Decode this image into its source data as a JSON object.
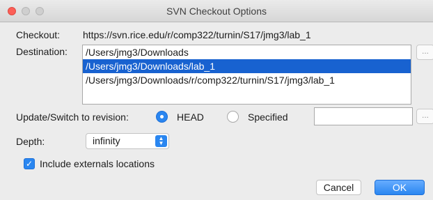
{
  "window": {
    "title": "SVN Checkout Options"
  },
  "checkout": {
    "label": "Checkout:",
    "url": "https://svn.rice.edu/r/comp322/turnin/S17/jmg3/lab_1"
  },
  "destination": {
    "label": "Destination:",
    "items": [
      {
        "label": "/Users/jmg3/Downloads",
        "selected": false
      },
      {
        "label": "/Users/jmg3/Downloads/lab_1",
        "selected": true
      },
      {
        "label": "/Users/jmg3/Downloads/r/comp322/turnin/S17/jmg3/lab_1",
        "selected": false
      }
    ],
    "browse_label": "..."
  },
  "revision": {
    "label": "Update/Switch to revision:",
    "head_label": "HEAD",
    "specified_label": "Specified",
    "selected": "HEAD",
    "specified_value": "",
    "browse_label": "..."
  },
  "depth": {
    "label": "Depth:",
    "value": "infinity"
  },
  "externals": {
    "label": "Include externals locations",
    "checked": true
  },
  "buttons": {
    "cancel": "Cancel",
    "ok": "OK"
  },
  "colors": {
    "accent": "#2a86f0",
    "selection": "#1862d0",
    "close_button": "#fc5f57"
  }
}
